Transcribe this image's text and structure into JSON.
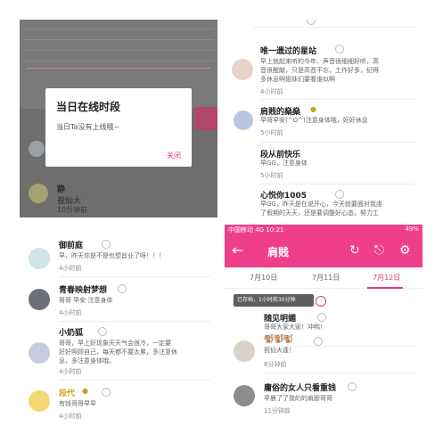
{
  "top_left": {
    "dialog": {
      "title": "当日在线时段",
      "message": "当日Ta没有上线哦~",
      "close_label": "关闭"
    },
    "behind": {
      "name": "静",
      "body": "祝仙大",
      "time": "10分钟前"
    }
  },
  "top_right": {
    "items": [
      {
        "name": "唯一遗过的星站",
        "body_lines": [
          "早上就起来听的今年、声音很细细好听，高",
          "音很醒献，只是高音不忘，工作好多，纪得",
          "多休息啊姐妹们要看谁似啊"
        ],
        "time": "4小时前"
      },
      {
        "name": "肩贱的燊燊",
        "body_lines": [
          "早哥早安(^O^)注意身体哦，好好休息"
        ],
        "time": "5小时前"
      },
      {
        "name": "段从前快乐",
        "body_lines": [
          "早GG，注意身体"
        ],
        "time": "5小时前"
      },
      {
        "name": "心悦你1005",
        "body_lines": [
          "早GG，昨天是在说开心，今天就要面对我虔",
          "了假期的天天，还是要调整好心态，努力工"
        ],
        "time": ""
      }
    ]
  },
  "bottom_left": {
    "items": [
      {
        "name": "御前庭",
        "body_lines": [
          "早，昨天你是不是也想旨业了呀！！！"
        ],
        "time": "4小时前"
      },
      {
        "name": "青春映射梦想",
        "body_lines": [
          "哥哥 早安 注意身体"
        ],
        "time": "4小时前"
      },
      {
        "name": "小奶狐",
        "body_lines": [
          "哥哥，早上好现象天天气会很冷，一定要",
          "好好照顾自己，每天都不要太累，多注意休",
          "息，多注意身体哦。"
        ],
        "time": "4小时前"
      },
      {
        "name": "段代",
        "body_lines": [
          "有钱哥哥早早"
        ],
        "time": "4小时前"
      }
    ]
  },
  "bottom_right": {
    "status_left": "中国移动 4G 10:21",
    "status_right": "49%",
    "title": "肩贱",
    "tabs": [
      "7月10日",
      "7月11日",
      "7月12日"
    ],
    "active_tab": 2,
    "toast": "已存档，1小时前30分钟",
    "items": [
      {
        "name": "随见明媚",
        "body_lines": [
          "哥哥大家大家！冲鸭！"
        ],
        "time": "8分钟前"
      },
      {
        "name": "🐒🐒🐒",
        "body_lines": [
          "祝仙大逢！"
        ],
        "time": "8分钟前"
      },
      {
        "name": "庸俗的女人只看重钱",
        "body_lines": [
          "早晨了了我的的肩膀哥哥"
        ],
        "time": "11分钟前"
      }
    ]
  },
  "colors": {
    "accent": "#ef3f8a",
    "link": "#e23b6e"
  }
}
